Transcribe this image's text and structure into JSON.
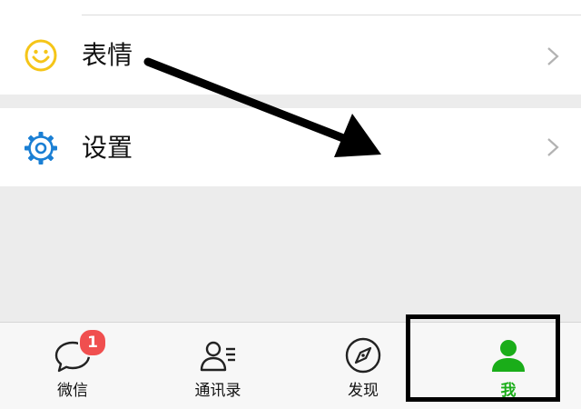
{
  "menu": {
    "items": [
      {
        "label": "表情",
        "icon": "smiley-icon",
        "icon_color": "#f5c518"
      },
      {
        "label": "设置",
        "icon": "gear-icon",
        "icon_color": "#1a7fd4"
      }
    ]
  },
  "tabbar": {
    "tabs": [
      {
        "label": "微信",
        "icon": "chat-bubble-icon",
        "badge": "1"
      },
      {
        "label": "通讯录",
        "icon": "contacts-icon"
      },
      {
        "label": "发现",
        "icon": "compass-icon"
      },
      {
        "label": "我",
        "icon": "person-icon",
        "active": true
      }
    ]
  },
  "colors": {
    "accent_green": "#1aad19",
    "badge_red": "#f04f4f",
    "annotation": "#000000"
  }
}
